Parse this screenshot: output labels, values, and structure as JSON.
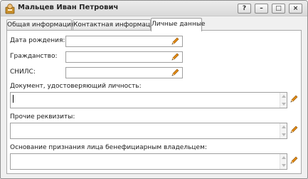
{
  "window": {
    "title": "Мальцев Иван Петрович",
    "buttons": {
      "help": "?",
      "minimize": "–",
      "maximize": "□",
      "close": "×"
    }
  },
  "tabs": [
    {
      "label": "Общая информация",
      "active": false
    },
    {
      "label": "Контактная информация",
      "active": false
    },
    {
      "label": "Личные данные",
      "active": true
    }
  ],
  "form": {
    "birth_date": {
      "label": "Дата рождения:",
      "value": ""
    },
    "citizenship": {
      "label": "Гражданство:",
      "value": ""
    },
    "snils": {
      "label": "СНИЛС:",
      "value": ""
    },
    "identity_document": {
      "label": "Документ, удостоверяющий личность:",
      "value": ""
    },
    "other_details": {
      "label": "Прочие реквизиты:",
      "value": ""
    },
    "beneficiary_basis": {
      "label": "Основание признания лица бенефициарным владельцем:",
      "value": ""
    }
  },
  "icons": {
    "edit": "pencil-icon",
    "app": "person-icon"
  },
  "colors": {
    "pencil": "#e38a12",
    "pencil_tip": "#3a3a3a",
    "border": "#a0a0a0"
  }
}
